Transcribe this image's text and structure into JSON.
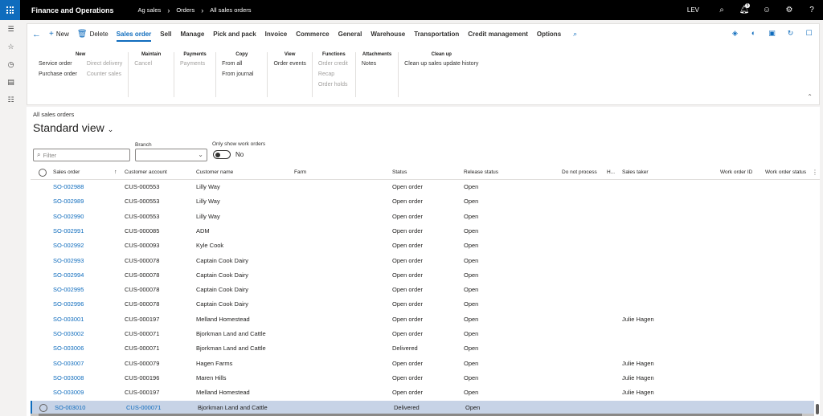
{
  "topbar": {
    "app_title": "Finance and Operations",
    "breadcrumbs": [
      "Ag sales",
      "Orders",
      "All sales orders"
    ],
    "company": "LEV",
    "notification_count": "5",
    "icons": [
      "search-icon",
      "notification-icon",
      "smiley-icon",
      "gear-icon",
      "help-icon"
    ]
  },
  "rail": {
    "icons": [
      "hamburger-icon",
      "star-icon",
      "clock-icon",
      "workspace-icon",
      "list-icon"
    ]
  },
  "action_pane": {
    "new_label": "New",
    "delete_label": "Delete",
    "tabs": [
      "Sales order",
      "Sell",
      "Manage",
      "Pick and pack",
      "Invoice",
      "Commerce",
      "General",
      "Warehouse",
      "Transportation",
      "Credit management",
      "Options"
    ],
    "active_tab": "Sales order",
    "groups": {
      "new": {
        "title": "New",
        "items": [
          "Service order",
          "Purchase order",
          "Direct delivery",
          "Counter sales"
        ]
      },
      "maintain": {
        "title": "Maintain",
        "items": [
          "Cancel"
        ]
      },
      "payments": {
        "title": "Payments",
        "items": [
          "Payments"
        ]
      },
      "copy": {
        "title": "Copy",
        "items": [
          "From all",
          "From journal"
        ]
      },
      "view": {
        "title": "View",
        "items": [
          "Order events"
        ]
      },
      "functions": {
        "title": "Functions",
        "items": [
          "Order credit",
          "Recap",
          "Order holds"
        ]
      },
      "attachments": {
        "title": "Attachments",
        "items": [
          "Notes"
        ]
      },
      "cleanup": {
        "title": "Clean up",
        "items": [
          "Clean up sales update history"
        ]
      }
    }
  },
  "page": {
    "subtitle": "All sales orders",
    "title": "Standard view",
    "filter_placeholder": "Filter",
    "branch_label": "Branch",
    "work_orders_label": "Only show work orders",
    "work_orders_value": "No"
  },
  "grid": {
    "columns": [
      "Sales order",
      "Customer account",
      "Customer name",
      "Farm",
      "Status",
      "Release status",
      "Do not process",
      "H...",
      "Sales taker",
      "Work order ID",
      "Work order status"
    ],
    "rows": [
      {
        "order": "SO-002988",
        "account": "CUS-000553",
        "name": "Lilly Way",
        "status": "Open order",
        "release": "Open",
        "taker": ""
      },
      {
        "order": "SO-002989",
        "account": "CUS-000553",
        "name": "Lilly Way",
        "status": "Open order",
        "release": "Open",
        "taker": ""
      },
      {
        "order": "SO-002990",
        "account": "CUS-000553",
        "name": "Lilly Way",
        "status": "Open order",
        "release": "Open",
        "taker": ""
      },
      {
        "order": "SO-002991",
        "account": "CUS-000085",
        "name": "ADM",
        "status": "Open order",
        "release": "Open",
        "taker": ""
      },
      {
        "order": "SO-002992",
        "account": "CUS-000093",
        "name": "Kyle Cook",
        "status": "Open order",
        "release": "Open",
        "taker": ""
      },
      {
        "order": "SO-002993",
        "account": "CUS-000078",
        "name": "Captain Cook Dairy",
        "status": "Open order",
        "release": "Open",
        "taker": ""
      },
      {
        "order": "SO-002994",
        "account": "CUS-000078",
        "name": "Captain Cook Dairy",
        "status": "Open order",
        "release": "Open",
        "taker": ""
      },
      {
        "order": "SO-002995",
        "account": "CUS-000078",
        "name": "Captain Cook Dairy",
        "status": "Open order",
        "release": "Open",
        "taker": ""
      },
      {
        "order": "SO-002996",
        "account": "CUS-000078",
        "name": "Captain Cook Dairy",
        "status": "Open order",
        "release": "Open",
        "taker": ""
      },
      {
        "order": "SO-003001",
        "account": "CUS-000197",
        "name": "Melland Homestead",
        "status": "Open order",
        "release": "Open",
        "taker": "Julie Hagen"
      },
      {
        "order": "SO-003002",
        "account": "CUS-000071",
        "name": "Bjorkman Land and Cattle",
        "status": "Open order",
        "release": "Open",
        "taker": ""
      },
      {
        "order": "SO-003006",
        "account": "CUS-000071",
        "name": "Bjorkman Land and Cattle",
        "status": "Delivered",
        "release": "Open",
        "taker": ""
      },
      {
        "order": "SO-003007",
        "account": "CUS-000079",
        "name": "Hagen Farms",
        "status": "Open order",
        "release": "Open",
        "taker": "Julie Hagen"
      },
      {
        "order": "SO-003008",
        "account": "CUS-000196",
        "name": "Maren Hills",
        "status": "Open order",
        "release": "Open",
        "taker": "Julie Hagen"
      },
      {
        "order": "SO-003009",
        "account": "CUS-000197",
        "name": "Melland Homestead",
        "status": "Open order",
        "release": "Open",
        "taker": "Julie Hagen"
      },
      {
        "order": "SO-003010",
        "account": "CUS-000071",
        "name": "Bjorkman Land and Cattle",
        "status": "Delivered",
        "release": "Open",
        "taker": ""
      }
    ],
    "selected_index": 15
  }
}
